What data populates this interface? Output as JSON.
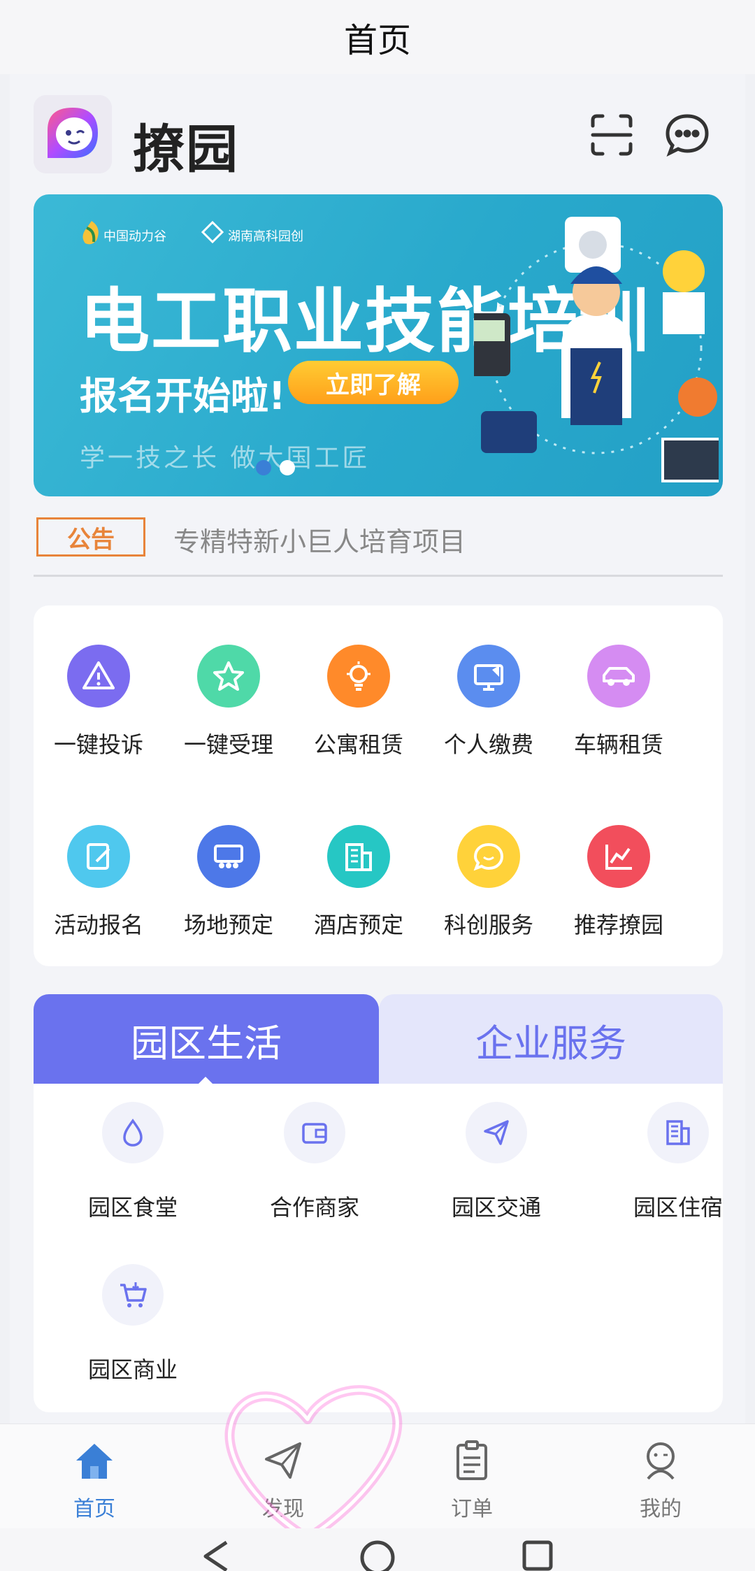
{
  "status_title": "首页",
  "header": {
    "app_name": "撩园",
    "scan_icon": "scan-icon",
    "message_icon": "chat-bubble-icon"
  },
  "banner": {
    "brand_left": "中国动力谷",
    "brand_right": "湖南高科园创",
    "title": "电工职业技能培训",
    "subtitle": "报名开始啦!",
    "button": "立即了解",
    "slogan": "学一技之长  做大国工匠",
    "slides": 2,
    "active_slide": 2
  },
  "notice": {
    "badge": "公告",
    "text": "专精特新小巨人培育项目"
  },
  "quick_menu": [
    {
      "label": "一键投诉",
      "icon": "warning-icon",
      "color": "#7b6cf0"
    },
    {
      "label": "一键受理",
      "icon": "star-icon",
      "color": "#4fd9a8"
    },
    {
      "label": "公寓租赁",
      "icon": "lightbulb-icon",
      "color": "#ff8a2a"
    },
    {
      "label": "个人缴费",
      "icon": "monitor-icon",
      "color": "#5b8def"
    },
    {
      "label": "车辆租赁",
      "icon": "car-icon",
      "color": "#d58cf2"
    },
    {
      "label": "活动报名",
      "icon": "edit-icon",
      "color": "#4fc8ee"
    },
    {
      "label": "场地预定",
      "icon": "venue-icon",
      "color": "#4d78e8"
    },
    {
      "label": "酒店预定",
      "icon": "building-icon",
      "color": "#26c7c4"
    },
    {
      "label": "科创服务",
      "icon": "chat-icon",
      "color": "#ffd23a"
    },
    {
      "label": "推荐撩园",
      "icon": "trend-icon",
      "color": "#f24e5c"
    }
  ],
  "tabs": {
    "active": "园区生活",
    "inactive": "企业服务"
  },
  "services": [
    {
      "label": "园区食堂",
      "icon": "water-drop-icon"
    },
    {
      "label": "合作商家",
      "icon": "wallet-icon"
    },
    {
      "label": "园区交通",
      "icon": "send-icon"
    },
    {
      "label": "园区住宿",
      "icon": "building-icon"
    },
    {
      "label": "园区商业",
      "icon": "cart-icon"
    }
  ],
  "bottom_nav": [
    {
      "label": "首页",
      "icon": "home-icon",
      "active": true
    },
    {
      "label": "发现",
      "icon": "paper-plane-icon",
      "active": false
    },
    {
      "label": "订单",
      "icon": "clipboard-icon",
      "active": false
    },
    {
      "label": "我的",
      "icon": "user-icon",
      "active": false
    }
  ],
  "colors": {
    "accent": "#6a72ee",
    "nav_active": "#3a7fd6",
    "notice": "#e8843a",
    "highlight": "#ff5fd6"
  }
}
